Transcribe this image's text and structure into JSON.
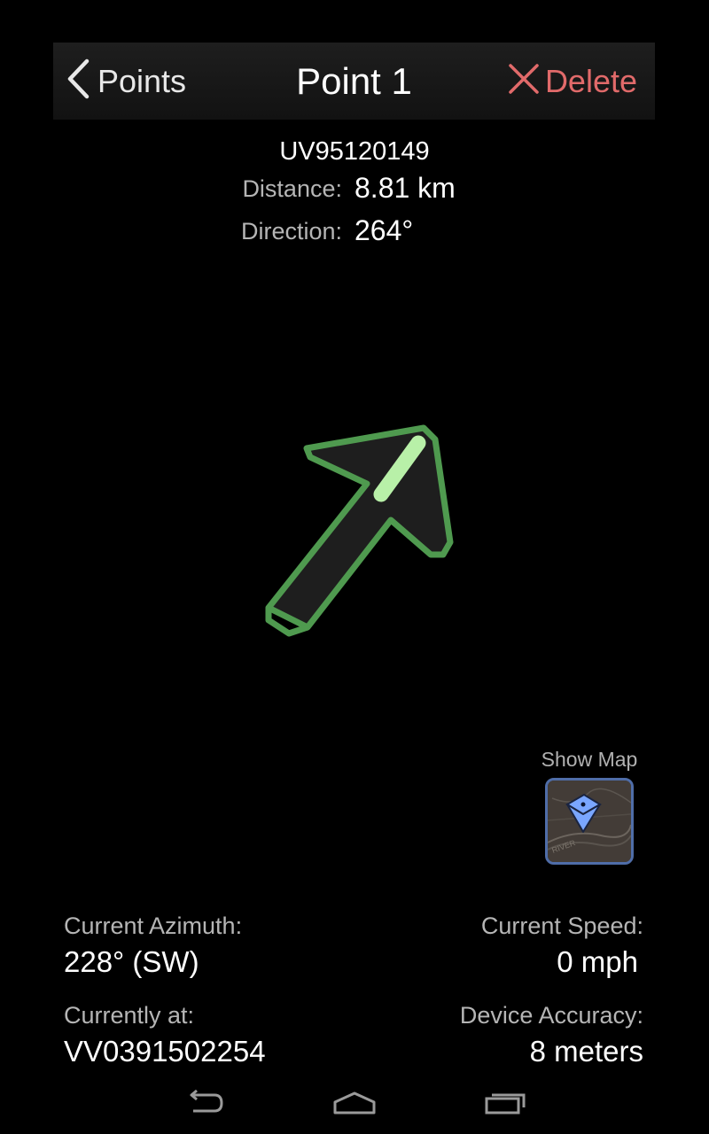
{
  "header": {
    "back_label": "Points",
    "title": "Point 1",
    "delete_label": "Delete",
    "delete_color": "#e16a6a"
  },
  "target": {
    "grid_reference": "UV95120149",
    "distance_label": "Distance:",
    "distance_value": "8.81 km",
    "direction_label": "Direction:",
    "direction_value": "264°"
  },
  "arrow": {
    "icon": "direction-arrow-icon",
    "outline_color": "#4f9a4f",
    "highlight_color": "#b8f0a8"
  },
  "map": {
    "label": "Show Map",
    "icon": "map-thumbnail-icon",
    "pin_color": "#7aa6ff"
  },
  "stats": {
    "azimuth_label": "Current Azimuth:",
    "azimuth_value": "228° (SW)",
    "speed_label": "Current Speed:",
    "speed_value": "0 mph",
    "location_label": "Currently at:",
    "location_value": "VV0391502254",
    "accuracy_label": "Device Accuracy:",
    "accuracy_value": "8 meters"
  },
  "navbar": {
    "back_icon": "back-icon",
    "home_icon": "home-icon",
    "recents_icon": "recents-icon"
  }
}
